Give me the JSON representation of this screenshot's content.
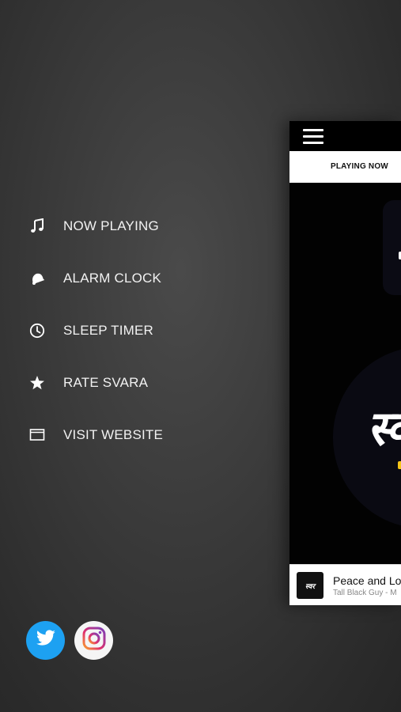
{
  "menu": {
    "items": [
      {
        "label": "NOW PLAYING",
        "icon": "music-note-icon"
      },
      {
        "label": "ALARM CLOCK",
        "icon": "bell-icon"
      },
      {
        "label": "SLEEP TIMER",
        "icon": "clock-icon"
      },
      {
        "label": "RATE SVARA",
        "icon": "star-icon"
      },
      {
        "label": "VISIT WEBSITE",
        "icon": "browser-window-icon"
      }
    ]
  },
  "social": {
    "twitter_icon": "twitter-icon",
    "instagram_icon": "instagram-icon",
    "twitter_color": "#1da1f2"
  },
  "panel": {
    "tab_label": "PLAYING NOW",
    "logo_text": "स्व",
    "mini_player": {
      "thumb_text": "स्वर",
      "title": "Peace and Love",
      "artist": "Tall Black Guy - M"
    }
  },
  "colors": {
    "background": "#3b3b3b",
    "accent_yellow": "#f5c518"
  }
}
